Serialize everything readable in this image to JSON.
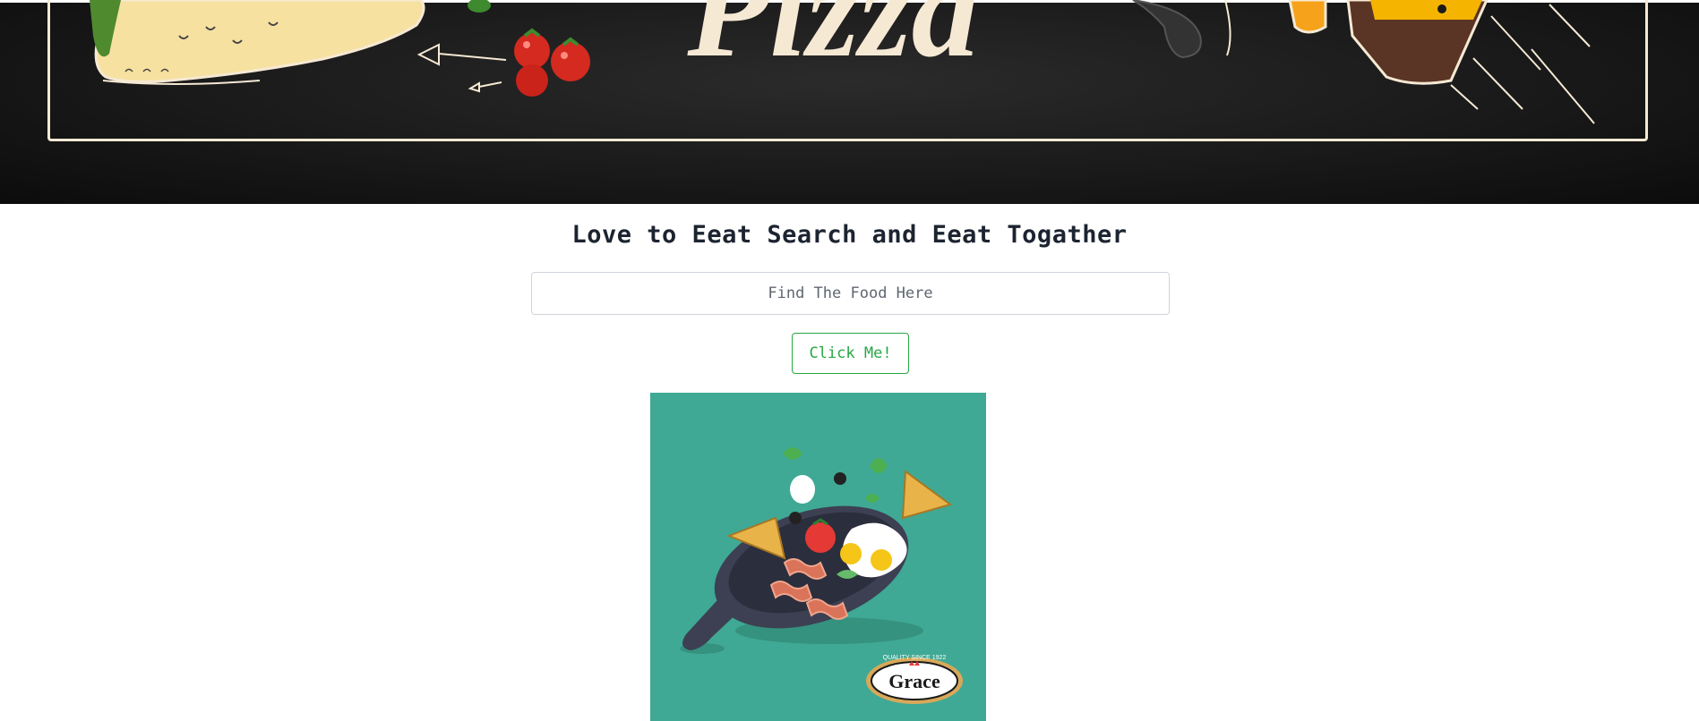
{
  "hero": {
    "title_text": "Pizza"
  },
  "main": {
    "headline": "Love to Eeat Search and Eeat Togather",
    "search": {
      "placeholder": "Find The Food Here",
      "value": ""
    },
    "button_label": "Click Me!",
    "image": {
      "brand": "Grace",
      "brand_tagline": "QUALITY SINCE 1922"
    }
  },
  "colors": {
    "hero_bg": "#141414",
    "hero_chalk": "#f6e9d4",
    "button_accent": "#28a745",
    "image_bg": "#3fa995"
  }
}
